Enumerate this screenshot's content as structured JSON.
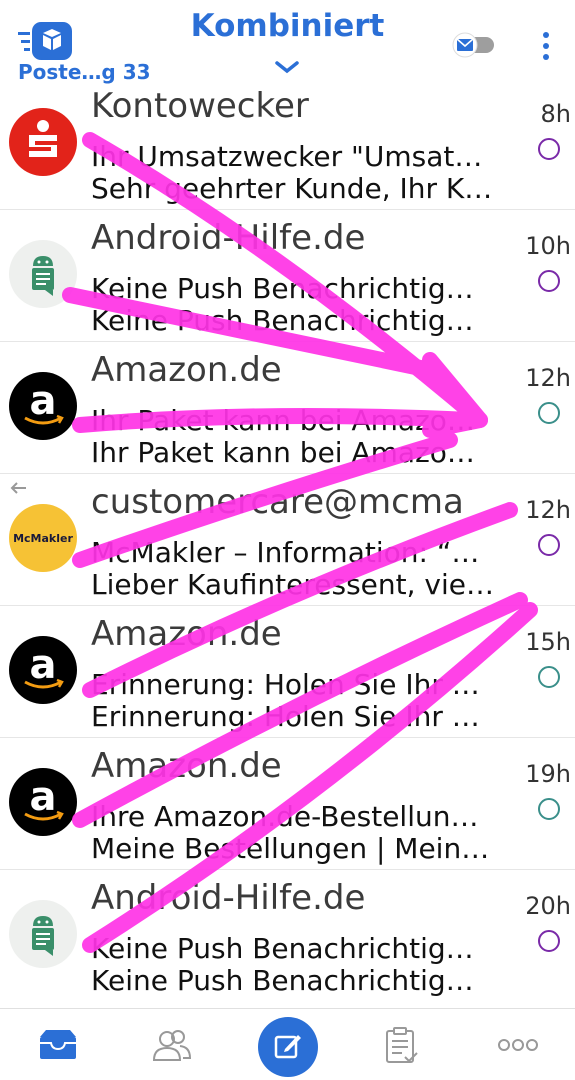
{
  "header": {
    "account_label": "Poste…g 33",
    "title": "Kombiniert",
    "accent_color": "#2b6fd6"
  },
  "emails": [
    {
      "sender": "Kontowecker",
      "subject": "Ihr Umsatzwecker \"Umsat…",
      "preview": "Sehr geehrter Kunde, Ihr K…",
      "time": "8h",
      "avatar": "sparkasse-logo",
      "status": "unread"
    },
    {
      "sender": "Android-Hilfe.de",
      "subject": "Keine Push Benachrichtig…",
      "preview": "Keine Push Benachrichtig…",
      "time": "10h",
      "avatar": "android-hilfe-logo",
      "status": "unread"
    },
    {
      "sender": "Amazon.de",
      "subject": "Ihr Paket kann bei Amazo…",
      "preview": "Ihr Paket kann bei Amazo…",
      "time": "12h",
      "avatar": "amazon-logo",
      "status": "read"
    },
    {
      "sender": "customercare@mcma",
      "subject": "McMakler – Information: “…",
      "preview": "Lieber Kaufinteressent, vie…",
      "time": "12h",
      "avatar": "mcmakler-logo",
      "avatar_text": "McMakler",
      "status": "unread",
      "replied": true
    },
    {
      "sender": "Amazon.de",
      "subject": "Erinnerung: Holen Sie Ihr …",
      "preview": "Erinnerung: Holen Sie Ihr …",
      "time": "15h",
      "avatar": "amazon-logo",
      "status": "read"
    },
    {
      "sender": "Amazon.de",
      "subject": "Ihre Amazon.de-Bestellun…",
      "preview": "Meine Bestellungen | Mein…",
      "time": "19h",
      "avatar": "amazon-logo",
      "status": "read"
    },
    {
      "sender": "Android-Hilfe.de",
      "subject": "Keine Push Benachrichtig…",
      "preview": "Keine Push Benachrichtig…",
      "time": "20h",
      "avatar": "android-hilfe-logo",
      "status": "unread"
    }
  ],
  "bottom_nav": [
    "inbox-icon",
    "contacts-icon",
    "compose-icon",
    "tasks-icon",
    "more-icon"
  ],
  "colors": {
    "unread_dot": "#7a2aa8",
    "read_dot": "#3a8f8a",
    "scribble": "#ff33e6"
  }
}
